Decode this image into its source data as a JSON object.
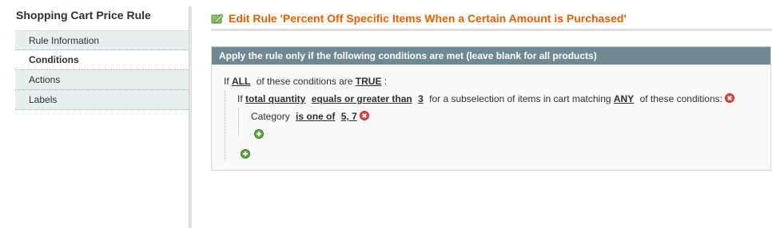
{
  "sidebar": {
    "title": "Shopping Cart Price Rule",
    "tabs": [
      {
        "label": "Rule Information"
      },
      {
        "label": "Conditions"
      },
      {
        "label": "Actions"
      },
      {
        "label": "Labels"
      }
    ]
  },
  "header": {
    "title": "Edit Rule 'Percent Off Specific Items When a Certain Amount is Purchased'"
  },
  "conditions": {
    "legend": "Apply the rule only if the following conditions are met (leave blank for all products)",
    "root": {
      "prefix": "If",
      "aggregator": "ALL",
      "middle": "of these conditions are",
      "value": "TRUE",
      "suffix": ":"
    },
    "subselect": {
      "prefix": "If",
      "attribute": "total quantity",
      "operator": "equals or greater than",
      "value": "3",
      "middle": "for a subselection of items in cart matching",
      "aggregator": "ANY",
      "suffix": "of these conditions:"
    },
    "category": {
      "label": "Category",
      "operator": "is one of",
      "value": "5, 7"
    }
  },
  "colors": {
    "accent": "#eb5e00",
    "legend_bg": "#6f8992",
    "tab_bg": "#e7efef",
    "remove": "#e04a46",
    "add": "#5aa83c"
  }
}
